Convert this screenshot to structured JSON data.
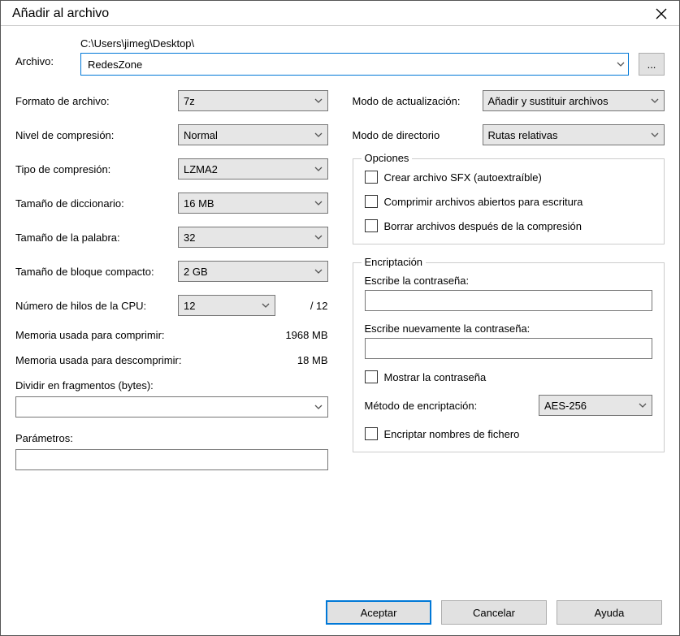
{
  "title": "Añadir al archivo",
  "archive": {
    "label": "Archivo:",
    "path": "C:\\Users\\jimeg\\Desktop\\",
    "value": "RedesZone",
    "browse": "..."
  },
  "left": {
    "format": {
      "label": "Formato de archivo:",
      "value": "7z"
    },
    "level": {
      "label": "Nivel de compresión:",
      "value": "Normal"
    },
    "method": {
      "label": "Tipo de compresión:",
      "value": "LZMA2"
    },
    "dict": {
      "label": "Tamaño de diccionario:",
      "value": "16 MB"
    },
    "word": {
      "label": "Tamaño de la palabra:",
      "value": "32"
    },
    "block": {
      "label": "Tamaño de bloque compacto:",
      "value": "2 GB"
    },
    "cpu": {
      "label": "Número de hilos de la CPU:",
      "value": "12",
      "total": "/ 12"
    },
    "mem_c": {
      "label": "Memoria usada para comprimir:",
      "value": "1968 MB"
    },
    "mem_d": {
      "label": "Memoria usada para descomprimir:",
      "value": "18 MB"
    },
    "split": {
      "label": "Dividir en fragmentos (bytes):",
      "value": ""
    },
    "params": {
      "label": "Parámetros:",
      "value": ""
    }
  },
  "right": {
    "update": {
      "label": "Modo de actualización:",
      "value": "Añadir y sustituir archivos"
    },
    "pathmode": {
      "label": "Modo de directorio",
      "value": "Rutas relativas"
    },
    "options": {
      "legend": "Opciones",
      "sfx": "Crear archivo SFX (autoextraíble)",
      "shared": "Comprimir archivos abiertos para escritura",
      "delete": "Borrar archivos después de la compresión"
    },
    "encryption": {
      "legend": "Encriptación",
      "pwd1_label": "Escribe la contraseña:",
      "pwd2_label": "Escribe nuevamente la contraseña:",
      "show": "Mostrar la contraseña",
      "method_label": "Método de encriptación:",
      "method_value": "AES-256",
      "encnames": "Encriptar nombres de fichero"
    }
  },
  "buttons": {
    "ok": "Aceptar",
    "cancel": "Cancelar",
    "help": "Ayuda"
  }
}
